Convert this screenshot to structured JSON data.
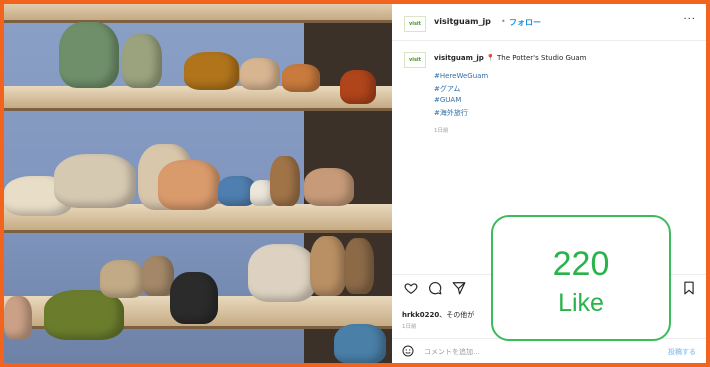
{
  "header": {
    "avatar_text": "visit",
    "username": "visitguam_jp",
    "separator": "•",
    "follow_label": "フォロー",
    "more_label": "···"
  },
  "caption": {
    "username": "visitguam_jp",
    "location_pin": "📍",
    "location": "The Potter's Studio Guam",
    "hashtags": [
      "#HereWeGuam",
      "#グアム",
      "#GUAM",
      "#海外旅行"
    ],
    "time_ago": "1日前"
  },
  "actions": {
    "like_icon": "heart-icon",
    "comment_icon": "comment-icon",
    "share_icon": "share-icon",
    "save_icon": "bookmark-icon"
  },
  "likes": {
    "user": "hrkk0220",
    "text": "、その他が",
    "time_ago": "1日前"
  },
  "comment_box": {
    "placeholder": "コメントを追加...",
    "post_label": "投稿する"
  },
  "badge": {
    "count": "220",
    "label": "Like"
  },
  "colors": {
    "frame": "#f2641e",
    "badge_green": "#28b34b",
    "link_blue": "#1a8fd8"
  }
}
